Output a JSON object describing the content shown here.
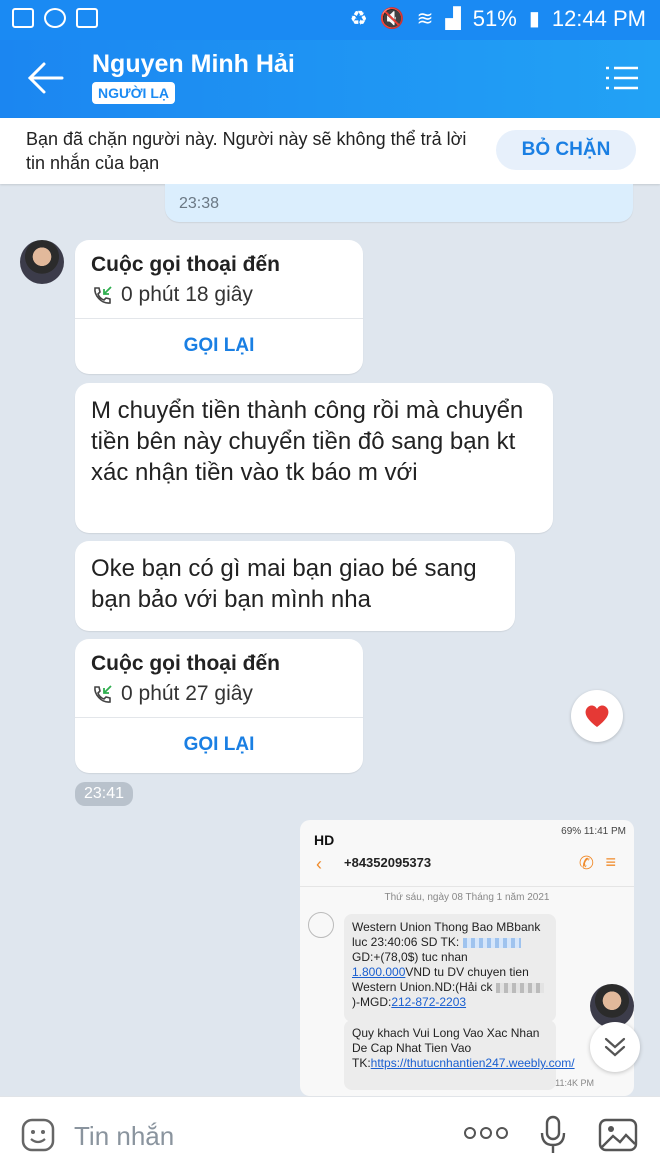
{
  "status_bar": {
    "battery": "51%",
    "time": "12:44 PM"
  },
  "header": {
    "name": "Nguyen Minh Hải",
    "badge": "NGƯỜI LẠ"
  },
  "block_notice": {
    "text": "Bạn đã chặn người này. Người này sẽ không thể trả lời tin nhắn của bạn",
    "unblock_label": "BỎ CHẶN"
  },
  "prev_time": "23:38",
  "call1": {
    "title": "Cuộc gọi thoại đến",
    "duration": "0 phút 18 giây",
    "recall": "GỌI LẠI"
  },
  "msg1": "M chuyển tiền thành công rồi mà chuyển tiền bên này chuyển tiền đô sang bạn kt xác nhận tiền vào tk báo m với",
  "msg2": "Oke bạn có gì mai bạn giao bé sang bạn bảo với bạn mình nha",
  "call2": {
    "title": "Cuộc gọi thoại đến",
    "duration": "0 phút 27 giây",
    "recall": "GỌI LẠI"
  },
  "time_chip": "23:41",
  "screenshot": {
    "status": "69% 11:41 PM",
    "hd": "HD",
    "number": "+84352095373",
    "date": "Thứ sáu, ngày 08 Tháng 1 năm 2021",
    "sms1_a": "Western Union Thong Bao MBbank luc 23:40:06 SD TK:",
    "sms1_b": "GD:+(78,0$) tuc nhan",
    "sms1_amount": "1.800.000",
    "sms1_c": "VND tu DV chuyen tien Western Union.ND:(Hải ck",
    "sms1_d": ")-MGD:",
    "sms1_phone": "212-872-2203",
    "sms2_a": "Quy khach Vui Long Vao Xac Nhan De Cap Nhat Tien Vao TK:",
    "sms2_link": "https://thutucnhantien247.weebly.com/",
    "time": "11:4K PM"
  },
  "input": {
    "placeholder": "Tin nhắn"
  },
  "colors": {
    "header": "#1a8af3",
    "accent": "#1a7fe3",
    "heart": "#e53935"
  }
}
